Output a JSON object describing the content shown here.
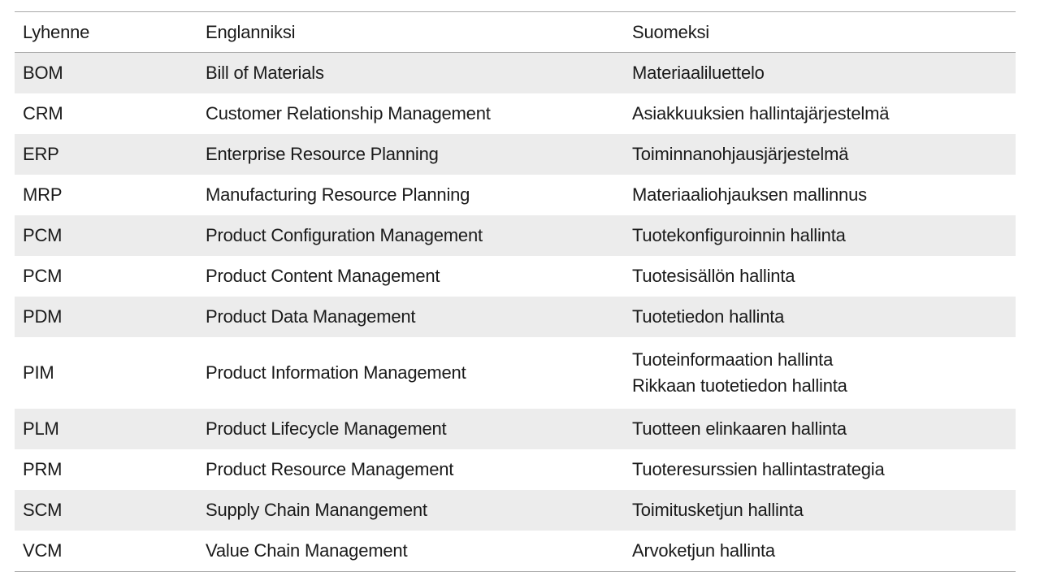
{
  "table": {
    "headers": [
      "Lyhenne",
      "Englanniksi",
      "Suomeksi"
    ],
    "rows": [
      {
        "abbr": "BOM",
        "en": "Bill of Materials",
        "fi": [
          "Materiaaliluettelo"
        ]
      },
      {
        "abbr": "CRM",
        "en": "Customer Relationship Management",
        "fi": [
          "Asiakkuuksien hallintajärjestelmä"
        ]
      },
      {
        "abbr": "ERP",
        "en": "Enterprise Resource Planning",
        "fi": [
          "Toiminnanohjausjärjestelmä"
        ]
      },
      {
        "abbr": "MRP",
        "en": "Manufacturing Resource Planning",
        "fi": [
          "Materiaaliohjauksen mallinnus"
        ]
      },
      {
        "abbr": "PCM",
        "en": "Product Configuration Management",
        "fi": [
          "Tuotekonfiguroinnin hallinta"
        ]
      },
      {
        "abbr": "PCM",
        "en": "Product Content Management",
        "fi": [
          "Tuotesisällön hallinta"
        ]
      },
      {
        "abbr": "PDM",
        "en": "Product Data Management",
        "fi": [
          "Tuotetiedon hallinta"
        ]
      },
      {
        "abbr": "PIM",
        "en": "Product Information Management",
        "fi": [
          "Tuoteinformaation hallinta",
          "Rikkaan tuotetiedon hallinta"
        ]
      },
      {
        "abbr": "PLM",
        "en": "Product Lifecycle Management",
        "fi": [
          "Tuotteen elinkaaren hallinta"
        ]
      },
      {
        "abbr": "PRM",
        "en": "Product Resource Management",
        "fi": [
          "Tuoteresurssien hallintastrategia"
        ]
      },
      {
        "abbr": "SCM",
        "en": "Supply Chain Manangement",
        "fi": [
          "Toimitusketjun hallinta"
        ]
      },
      {
        "abbr": "VCM",
        "en": "Value Chain Management",
        "fi": [
          "Arvoketjun hallinta"
        ]
      }
    ]
  },
  "colors": {
    "row_shade": "#ececec",
    "rule": "#a8a8a8",
    "text": "#1a1a1a"
  }
}
